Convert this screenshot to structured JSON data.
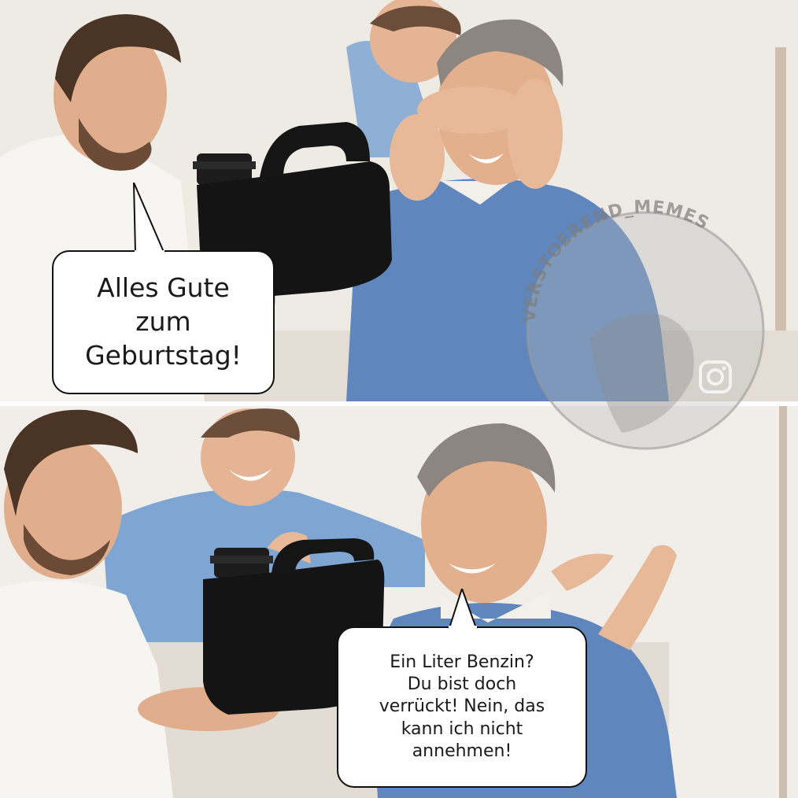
{
  "meme": {
    "panel_top": {
      "speech_bubble": "Alles Gute\nzum\nGeburtstag!"
    },
    "panel_bottom": {
      "speech_bubble": "Ein Liter Benzin?\nDu bist doch\nverrückt! Nein, das\nkann ich nicht\nannehmen!"
    },
    "watermark": {
      "text": "VERSTOEREND_MEMES",
      "icon": "instagram-icon"
    }
  },
  "colors": {
    "background": "#f2efea",
    "sweater_blue": "#5f86bd",
    "shirt_white": "#f7f5f2",
    "canister_black": "#141414",
    "skin": "#e3b08e",
    "hair_brown": "#4a3426",
    "hair_gray": "#8d8680"
  }
}
